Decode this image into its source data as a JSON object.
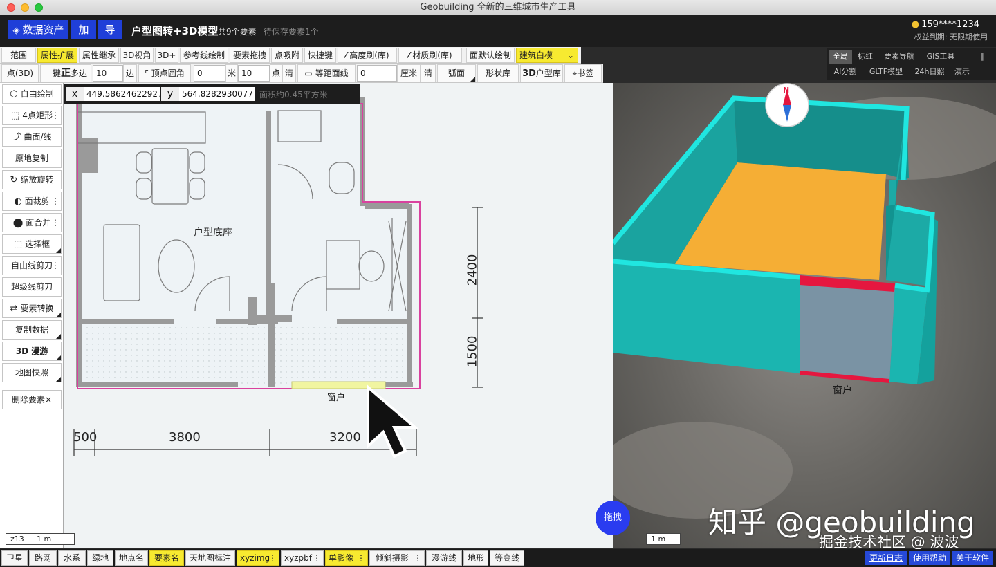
{
  "window": {
    "title": "Geobuilding 全新的三维城市生产工具"
  },
  "header": {
    "data_assets": "数据资产",
    "add": "加",
    "guide": "导",
    "title": "户型图转+3D模型",
    "element_count": "共9个要素",
    "pending_save": "待保存要素1个",
    "user": "159****1234",
    "rights": "权益到期: 无限期使用"
  },
  "toolbar1": {
    "range": "范围",
    "attr_extend": "属性扩展",
    "attr_inherit": "属性继承",
    "view3d": "3D视角",
    "plus3d": "3D+",
    "ref_line": "参考线绘制",
    "element_drag": "要素拖拽",
    "snap": "点吸附",
    "shortcut": "快捷键",
    "height_brush": "高度刷(库)",
    "material_brush": "材质刷(库)",
    "face_default": "面默认绘制",
    "building_select": "建筑白模"
  },
  "toolbar2": {
    "point3d": "点(3D)",
    "one_key": "一键",
    "regular": "正",
    "polygon": "多边",
    "sides_value": "10",
    "sides_unit": "边",
    "vertex_round": "顶点圆角",
    "round_value": "0",
    "round_unit": "米",
    "points_value": "10",
    "points_unit": "点",
    "clear1": "清",
    "equidistant": "等距面线",
    "equidistant_value": "0",
    "cm_unit": "厘米",
    "clear2": "清",
    "arc": "弧面",
    "shape_lib": "形状库",
    "unit3d_prefix": "3D",
    "unit3d": "户型库",
    "bookmark": "书签"
  },
  "right_tabs": [
    "全局",
    "标红",
    "要素导航",
    "GIS工具",
    "AI分割",
    "GLTF模型",
    "24h日照",
    "演示"
  ],
  "right_tabs_toggle": "‖",
  "left_tools": [
    {
      "label": "自由绘制",
      "icon": "⬡"
    },
    {
      "label": "4点矩形",
      "icon": "⬚",
      "dots": "⋮"
    },
    {
      "label": "曲面/线",
      "icon": "⤴"
    },
    {
      "label": "原地复制"
    },
    {
      "label": "缩放旋转",
      "icon": "↻"
    },
    {
      "label": "面裁剪",
      "icon": "◐",
      "dots": "⋮"
    },
    {
      "label": "面合并",
      "icon": "⬤",
      "dots": "⋮"
    },
    {
      "label": "选择框",
      "icon": "⬚"
    },
    {
      "label": "自由线剪刀",
      "dots": "⋮"
    },
    {
      "label": "超级线剪刀"
    },
    {
      "label": "要素转换",
      "icon": "⇄"
    },
    {
      "label": "复制数据"
    },
    {
      "label": "3D 漫游"
    },
    {
      "label": "地图快照"
    }
  ],
  "delete_element": "删除要素×",
  "coords": {
    "x_label": "x",
    "x_value": "449.58624622927",
    "y_label": "y",
    "y_value": "564.82829300777",
    "area": "面积约0.45平方米"
  },
  "plan": {
    "room_label": "户型底座",
    "window_label": "窗户",
    "dim_v1": "2400",
    "dim_v2": "1500",
    "dim_h1": "500",
    "dim_h2": "3800",
    "dim_h3": "3200"
  },
  "view3d": {
    "window_label": "窗户",
    "compass_letter": "N"
  },
  "zoom_level": "z13",
  "scale2d": "1 m",
  "scale3d": "1 m",
  "drag_button": "拖拽",
  "watermark1": "知乎 @geobuilding",
  "watermark2": "掘金技术社区 @ 波波",
  "bottom_layers": [
    {
      "label": "卫星"
    },
    {
      "label": "路网"
    },
    {
      "label": "水系"
    },
    {
      "label": "绿地"
    },
    {
      "label": "地点名"
    },
    {
      "label": "要素名",
      "highlight": true
    },
    {
      "label": "天地图标注"
    },
    {
      "label": "xyzimg",
      "highlight": true,
      "dots": true
    },
    {
      "label": "xyzpbf",
      "dots": true
    },
    {
      "label": "单影像",
      "highlight": true,
      "dots": true
    },
    {
      "label": "倾斜摄影",
      "dots": true
    },
    {
      "label": "漫游线"
    },
    {
      "label": "地形"
    },
    {
      "label": "等高线"
    }
  ],
  "bottom_right": [
    "更新日志",
    "使用帮助",
    "关于软件"
  ],
  "colors": {
    "accent_blue": "#1f3fd8",
    "highlight_yellow": "#f7ea30",
    "wall_cyan": "#1bb5b0",
    "floor_orange": "#f5ae35",
    "window_red": "#e5173f",
    "boundary_pink": "#d9419e"
  }
}
